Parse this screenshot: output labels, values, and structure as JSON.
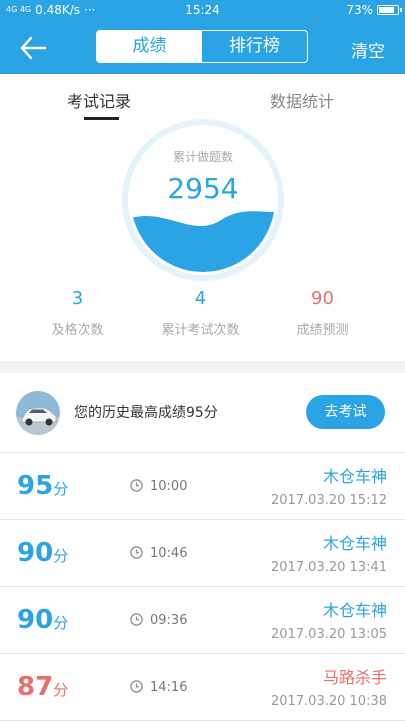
{
  "status_bar": {
    "signal": "4G 4G",
    "speed": "0.48K/s",
    "dots": "···",
    "time": "15:24",
    "battery": "73%",
    "battery_level": 0.73
  },
  "header": {
    "segments": [
      "成绩",
      "排行榜"
    ],
    "active_segment": "成绩",
    "clear_label": "清空"
  },
  "tabs": {
    "records": "考试记录",
    "stats": "数据统计"
  },
  "gauge": {
    "label": "累计做题数",
    "value": "2954"
  },
  "stats": [
    {
      "value": "3",
      "label": "及格次数"
    },
    {
      "value": "4",
      "label": "累计考试次数"
    },
    {
      "value": "90",
      "label": "成绩预测"
    }
  ],
  "best": {
    "text": "您的历史最高成绩95分",
    "button": "去考试"
  },
  "score_unit": "分",
  "records": [
    {
      "score": "95",
      "duration": "10:00",
      "name": "木仓车神",
      "date": "2017.03.20  15:12",
      "color": "#2ba4e6"
    },
    {
      "score": "90",
      "duration": "10:46",
      "name": "木仓车神",
      "date": "2017.03.20  13:41",
      "color": "#2ba4e6"
    },
    {
      "score": "90",
      "duration": "09:36",
      "name": "木仓车神",
      "date": "2017.03.20  13:05",
      "color": "#2ba4e6"
    },
    {
      "score": "87",
      "duration": "14:16",
      "name": "马路杀手",
      "date": "2017.03.20  10:38",
      "color": "#e8706c"
    }
  ],
  "colors": {
    "primary": "#2ba4e6",
    "red": "#e8706c"
  }
}
